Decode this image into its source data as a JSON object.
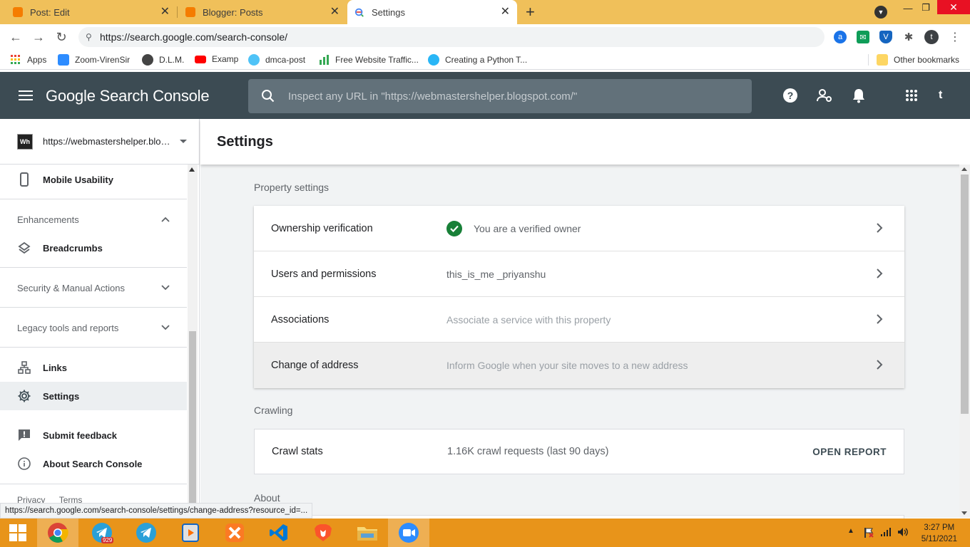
{
  "browser": {
    "tabs": [
      {
        "title": "Post: Edit",
        "color": "#f57c00"
      },
      {
        "title": "Blogger: Posts",
        "color": "#f57c00"
      },
      {
        "title": "Settings",
        "color": "#4285f4"
      }
    ],
    "url": "https://search.google.com/search-console/",
    "bookmarks": [
      "Apps",
      "Zoom-VirenSir",
      "D.L.M.",
      "Examp",
      "dmca-post",
      "Free Website Traffic...",
      "Creating a Python T...",
      "Other bookmarks"
    ],
    "profile_initial": "t",
    "status_url": "https://search.google.com/search-console/settings/change-address?resource_id=..."
  },
  "header": {
    "logo_text": "Google Search Console",
    "search_placeholder": "Inspect any URL in \"https://webmastershelper.blogspot.com/\"",
    "avatar_initial": "t"
  },
  "sidebar": {
    "property_url": "https://webmastershelper.blogspot.com/",
    "property_icon_text": "Wh",
    "mobile_usability": "Mobile Usability",
    "enhancements": "Enhancements",
    "breadcrumbs": "Breadcrumbs",
    "security": "Security & Manual Actions",
    "legacy": "Legacy tools and reports",
    "links": "Links",
    "settings": "Settings",
    "submit_feedback": "Submit feedback",
    "about": "About Search Console",
    "privacy": "Privacy",
    "terms": "Terms"
  },
  "main": {
    "title": "Settings",
    "property_settings_title": "Property settings",
    "rows": [
      {
        "label": "Ownership verification",
        "value": "You are a verified owner"
      },
      {
        "label": "Users and permissions",
        "value": "this_is_me _priyanshu"
      },
      {
        "label": "Associations",
        "value": "Associate a service with this property"
      },
      {
        "label": "Change of address",
        "value": "Inform Google when your site moves to a new address"
      }
    ],
    "crawling_title": "Crawling",
    "crawl_label": "Crawl stats",
    "crawl_value": "1.16K crawl requests (last 90 days)",
    "open_report": "OPEN REPORT",
    "about_title": "About"
  },
  "taskbar": {
    "time": "3:27 PM",
    "date": "5/11/2021",
    "telegram_badge": "929"
  },
  "colors": {
    "header_bg": "#3c4b53",
    "tabstrip_bg": "#f0c05a",
    "taskbar_bg": "#e8941a",
    "verified_green": "#188038"
  }
}
